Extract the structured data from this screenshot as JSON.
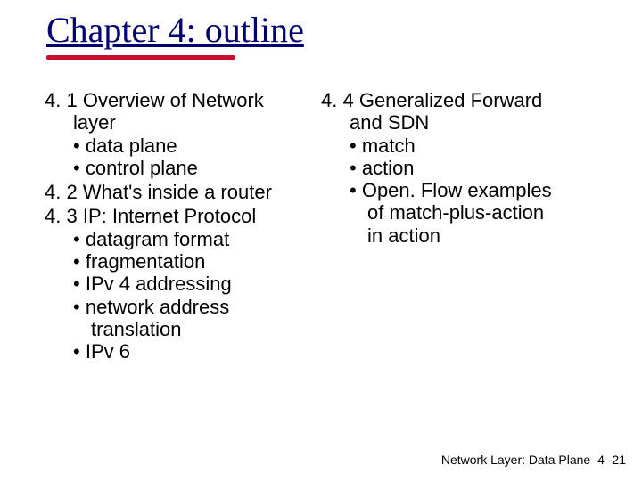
{
  "title": "Chapter 4: outline",
  "left": {
    "sections": [
      {
        "num": "4. 1",
        "heading_rest": "Overview of Network",
        "heading_cont": "layer",
        "bullets": [
          {
            "text": "data plane"
          },
          {
            "text": "control plane"
          }
        ]
      },
      {
        "num": "4. 2",
        "heading_rest": "What's inside a router",
        "bullets": []
      },
      {
        "num": "4. 3",
        "heading_rest": "IP: Internet Protocol",
        "bullets": [
          {
            "text": "datagram format"
          },
          {
            "text": "fragmentation"
          },
          {
            "text": "IPv 4 addressing"
          },
          {
            "text": "network address",
            "cont": "translation"
          },
          {
            "text": "IPv 6"
          }
        ]
      }
    ]
  },
  "right": {
    "sections": [
      {
        "num": "4. 4",
        "heading_rest": "Generalized Forward",
        "heading_cont": "and SDN",
        "bullets": [
          {
            "text": "match"
          },
          {
            "text": "action"
          },
          {
            "text": "Open. Flow  examples",
            "cont": "of match-plus-action",
            "cont2": "in action"
          }
        ]
      }
    ]
  },
  "footer": {
    "label": "Network Layer: Data Plane",
    "page": "4 -21"
  }
}
